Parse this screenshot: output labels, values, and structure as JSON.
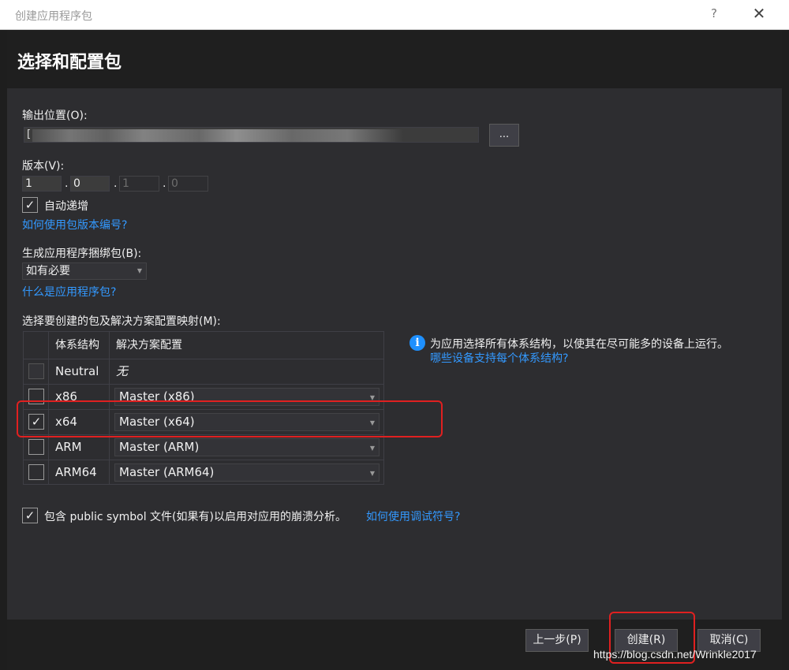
{
  "window": {
    "title": "创建应用程序包",
    "help_label": "?",
    "close_label": "✕"
  },
  "header": {
    "title": "选择和配置包"
  },
  "output": {
    "label": "输出位置(O):",
    "value": "[",
    "browse_label": "..."
  },
  "version": {
    "label": "版本(V):",
    "parts": [
      "1",
      "0",
      "1",
      "0"
    ],
    "separator": ".",
    "auto_increment_label": "自动递增",
    "auto_increment_checked": true,
    "help_link": "如何使用包版本编号?"
  },
  "bundle": {
    "label": "生成应用程序捆绑包(B):",
    "selected": "如有必要",
    "help_link": "什么是应用程序包?"
  },
  "mapping": {
    "label": "选择要创建的包及解决方案配置映射(M):",
    "columns": [
      "体系结构",
      "解决方案配置"
    ],
    "rows": [
      {
        "arch": "Neutral",
        "config": "无",
        "checked": false
      },
      {
        "arch": "x86",
        "config": "Master (x86)",
        "checked": false
      },
      {
        "arch": "x64",
        "config": "Master (x64)",
        "checked": true
      },
      {
        "arch": "ARM",
        "config": "Master (ARM)",
        "checked": false
      },
      {
        "arch": "ARM64",
        "config": "Master (ARM64)",
        "checked": false
      }
    ]
  },
  "info": {
    "icon": "info-icon",
    "text": "为应用选择所有体系结构，以使其在尽可能多的设备上运行。",
    "link": "哪些设备支持每个体系结构?"
  },
  "symbols": {
    "label": "包含 public symbol 文件(如果有)以启用对应用的崩溃分析。",
    "checked": true,
    "link": "如何使用调试符号?"
  },
  "footer": {
    "back_label": "上一步(P)",
    "create_label": "创建(R)",
    "cancel_label": "取消(C)"
  },
  "watermark": "https://blog.csdn.net/Wrinkle2017",
  "colors": {
    "background": "#2d2d30",
    "header": "#1f1f1f",
    "link": "#3399ff",
    "highlight": "#e02020"
  }
}
